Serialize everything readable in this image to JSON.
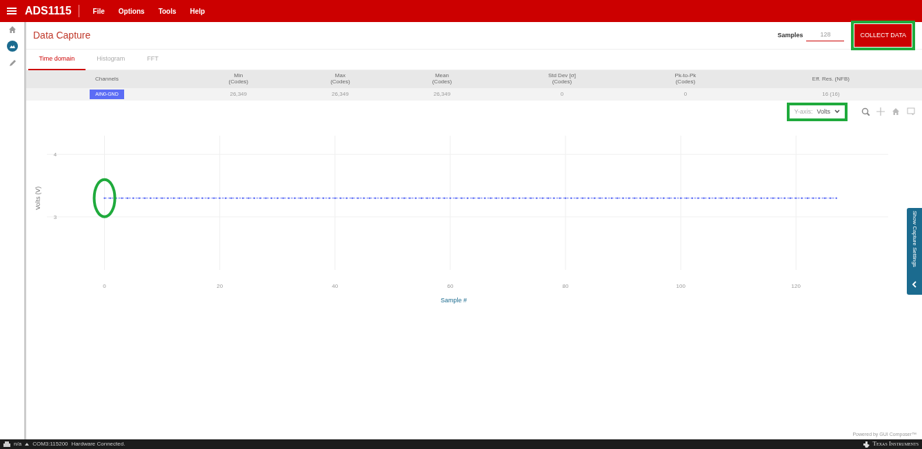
{
  "app": {
    "title": "ADS1115",
    "menu": [
      "File",
      "Options",
      "Tools",
      "Help"
    ]
  },
  "sidebar": {
    "items": [
      {
        "selected": false
      },
      {
        "selected": true
      },
      {
        "selected": false
      }
    ]
  },
  "page": {
    "title": "Data Capture",
    "samples_label": "Samples",
    "samples_value": "128",
    "collect_button": {
      "label": "COLLECT DATA",
      "highlighted": true
    }
  },
  "tabs": [
    {
      "label": "Time domain",
      "selected": true
    },
    {
      "label": "Histogram",
      "selected": false
    },
    {
      "label": "FFT",
      "selected": false
    }
  ],
  "table": {
    "columns": [
      {
        "label": "Channels"
      },
      {
        "label": "Min",
        "unit": "(Codes)"
      },
      {
        "label": "Max",
        "unit": "(Codes)"
      },
      {
        "label": "Mean",
        "unit": "(Codes)"
      },
      {
        "label": "Std Dev [σ]",
        "unit": "(Codes)"
      },
      {
        "label": "Pk-to-Pk",
        "unit": "(Codes)"
      },
      {
        "label": "Eff. Res. (NFB)"
      }
    ],
    "rows": [
      {
        "cells": [
          "AIN0-GND",
          "26,349",
          "26,349",
          "26,349",
          "0",
          "0",
          "16 (16)"
        ]
      }
    ]
  },
  "y_axis_select": {
    "label": "Y-axis:",
    "value": "Volts",
    "highlighted": true
  },
  "chart": {
    "first_point_highlighted": true,
    "chart_data": {
      "type": "line",
      "xlabel": "Sample #",
      "ylabel": "Volts (V)",
      "xlim": [
        -10,
        136
      ],
      "ylim": [
        2.15,
        4.3
      ],
      "xticks": [
        0,
        20,
        40,
        60,
        80,
        100,
        120
      ],
      "yticks": [
        3,
        4
      ],
      "grid": true,
      "x": [
        0,
        1,
        2,
        3,
        4,
        5,
        6,
        7,
        8,
        9,
        10,
        11,
        12,
        13,
        14,
        15,
        16,
        17,
        18,
        19,
        20,
        21,
        22,
        23,
        24,
        25,
        26,
        27,
        28,
        29,
        30,
        31,
        32,
        33,
        34,
        35,
        36,
        37,
        38,
        39,
        40,
        41,
        42,
        43,
        44,
        45,
        46,
        47,
        48,
        49,
        50,
        51,
        52,
        53,
        54,
        55,
        56,
        57,
        58,
        59,
        60,
        61,
        62,
        63,
        64,
        65,
        66,
        67,
        68,
        69,
        70,
        71,
        72,
        73,
        74,
        75,
        76,
        77,
        78,
        79,
        80,
        81,
        82,
        83,
        84,
        85,
        86,
        87,
        88,
        89,
        90,
        91,
        92,
        93,
        94,
        95,
        96,
        97,
        98,
        99,
        100,
        101,
        102,
        103,
        104,
        105,
        106,
        107,
        108,
        109,
        110,
        111,
        112,
        113,
        114,
        115,
        116,
        117,
        118,
        119,
        120,
        121,
        122,
        123,
        124,
        125,
        126,
        127
      ],
      "series": [
        {
          "color": "#5b6cf5",
          "line_style": "dashed",
          "values": [
            3.3,
            3.3,
            3.3,
            3.3,
            3.3,
            3.3,
            3.3,
            3.3,
            3.3,
            3.3,
            3.3,
            3.3,
            3.3,
            3.3,
            3.3,
            3.3,
            3.3,
            3.3,
            3.3,
            3.3,
            3.3,
            3.3,
            3.3,
            3.3,
            3.3,
            3.3,
            3.3,
            3.3,
            3.3,
            3.3,
            3.3,
            3.3,
            3.3,
            3.3,
            3.3,
            3.3,
            3.3,
            3.3,
            3.3,
            3.3,
            3.3,
            3.3,
            3.3,
            3.3,
            3.3,
            3.3,
            3.3,
            3.3,
            3.3,
            3.3,
            3.3,
            3.3,
            3.3,
            3.3,
            3.3,
            3.3,
            3.3,
            3.3,
            3.3,
            3.3,
            3.3,
            3.3,
            3.3,
            3.3,
            3.3,
            3.3,
            3.3,
            3.3,
            3.3,
            3.3,
            3.3,
            3.3,
            3.3,
            3.3,
            3.3,
            3.3,
            3.3,
            3.3,
            3.3,
            3.3,
            3.3,
            3.3,
            3.3,
            3.3,
            3.3,
            3.3,
            3.3,
            3.3,
            3.3,
            3.3,
            3.3,
            3.3,
            3.3,
            3.3,
            3.3,
            3.3,
            3.3,
            3.3,
            3.3,
            3.3,
            3.3,
            3.3,
            3.3,
            3.3,
            3.3,
            3.3,
            3.3,
            3.3,
            3.3,
            3.3,
            3.3,
            3.3,
            3.3,
            3.3,
            3.3,
            3.3,
            3.3,
            3.3,
            3.3,
            3.3,
            3.3,
            3.3,
            3.3,
            3.3,
            3.3,
            3.3,
            3.3,
            3.3
          ]
        }
      ]
    }
  },
  "side_tab": {
    "label": "Show Capture Settings",
    "expanded": false
  },
  "footer_note": "Powered by GUI Composer™",
  "status_bar": {
    "left": [
      "n/a",
      "COM3:115200",
      "Hardware Connected."
    ],
    "right": "Texas Instruments"
  }
}
